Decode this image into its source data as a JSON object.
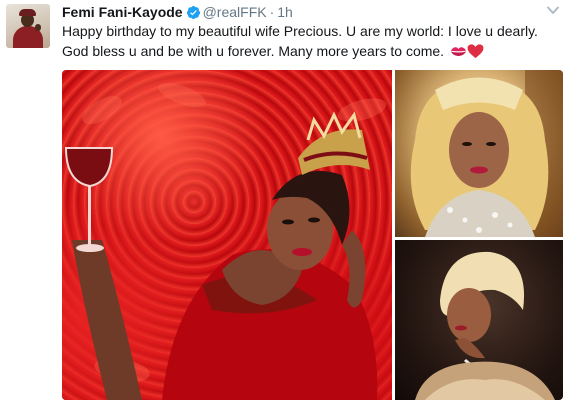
{
  "tweet": {
    "author_name": "Femi Fani-Kayode",
    "handle": "@realFFK",
    "separator": "·",
    "timestamp": "1h",
    "text": "Happy birthday to my beautiful wife Precious. U are my world: I love u dearly. God bless u and be with u forever. Many more years to come.",
    "emojis": [
      "kiss-mark",
      "red-heart"
    ]
  },
  "icons": {
    "verified": "verified-badge-icon",
    "caret": "chevron-down-icon"
  },
  "colors": {
    "verified_blue": "#1da1f2",
    "secondary_text": "#657786",
    "primary_text": "#14171a",
    "heart_red": "#e0245e"
  },
  "media": {
    "count": 3,
    "layout": "one large left, two stacked right"
  }
}
